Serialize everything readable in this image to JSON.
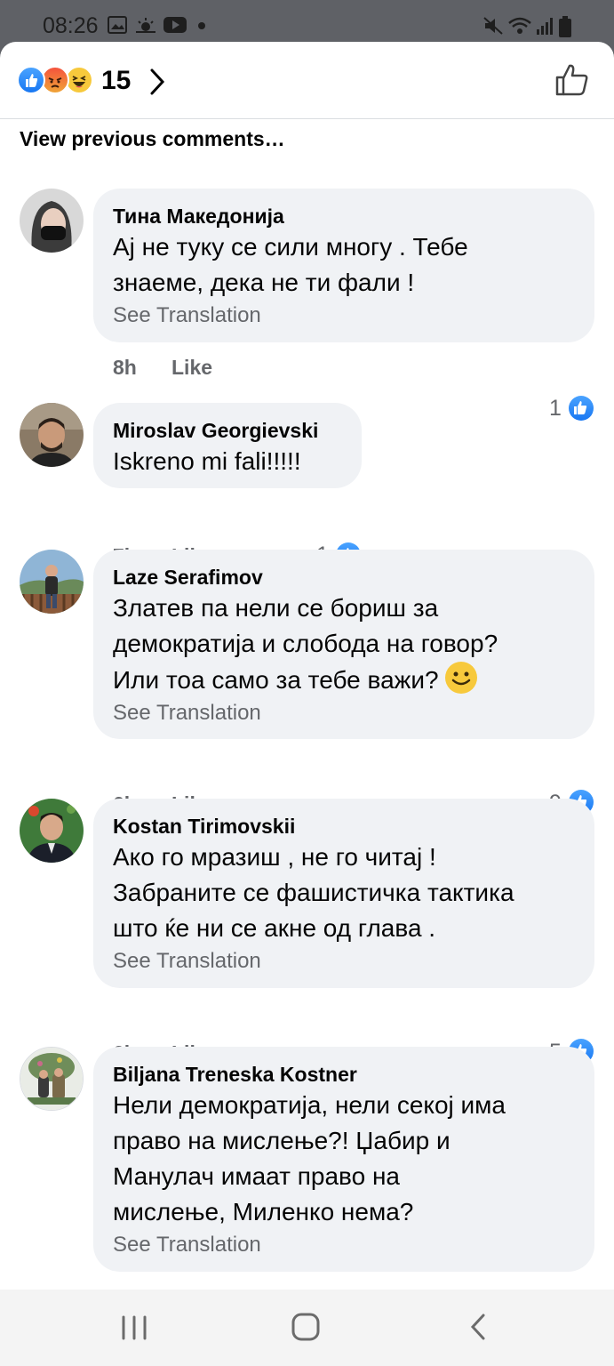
{
  "status_bar": {
    "time": "08:26"
  },
  "header": {
    "reaction_count": "15"
  },
  "view_previous": "View previous comments…",
  "comments": [
    {
      "author": "Тина Македонија",
      "text": "Ај не туку се сили многу . Тебе\nзнаеме, дека не ти фали !",
      "see_translation": "See Translation",
      "time": "8h",
      "like": "Like",
      "reactions": "1"
    },
    {
      "author": "Miroslav Georgievski",
      "text": "Iskreno mi fali!!!!!",
      "see_translation": "",
      "time": "7h",
      "like": "Like",
      "reactions": "1"
    },
    {
      "author": "Laze Serafimov",
      "text": "Златев па нели се бориш за\nдемократија и слобода на говор?\nИли тоа само за тебе важи?",
      "see_translation": "See Translation",
      "time": "6h",
      "like": "Like",
      "reactions": "9"
    },
    {
      "author": "Kostan Tirimovskii",
      "text": "Ако го мразиш , не го читај !\nЗабраните се фашистичка тактика\nшто ќе ни се акне од глава .",
      "see_translation": "See Translation",
      "time": "6h",
      "like": "Like",
      "reactions": "5"
    },
    {
      "author": "Biljana Treneska Kostner",
      "text": "Нели демократија, нели секој има\nправо на мислење?! Џабир и\nМанулач имаат право на\nмислење, Миленко нема?",
      "see_translation": "See Translation",
      "time": "",
      "like": "",
      "reactions": ""
    }
  ],
  "colors": {
    "accent": "#1877f2",
    "bubble": "#f0f2f5",
    "secondary_text": "#65676b"
  }
}
